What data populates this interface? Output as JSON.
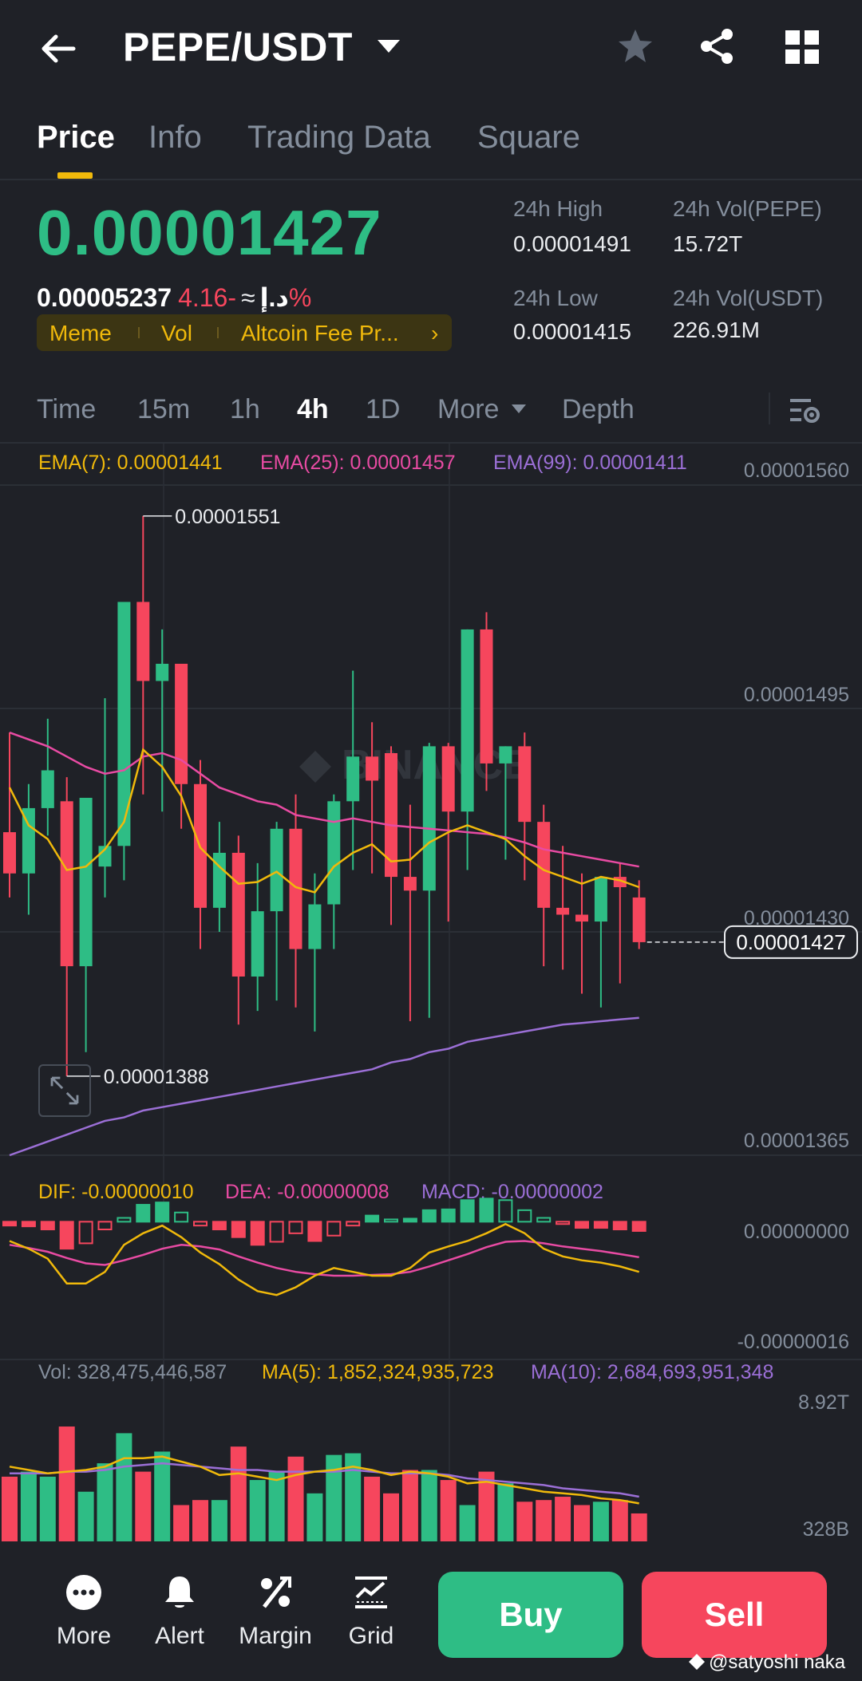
{
  "header": {
    "pair": "PEPE/USDT",
    "icons": [
      "back-arrow-icon",
      "caret-down-icon",
      "star-icon",
      "share-icon",
      "grid-icon"
    ]
  },
  "tabs": [
    {
      "label": "Price",
      "active": true
    },
    {
      "label": "Info",
      "active": false
    },
    {
      "label": "Trading Data",
      "active": false
    },
    {
      "label": "Square",
      "active": false
    }
  ],
  "ticker": {
    "last_price": "0.00001427",
    "fiat_price": "0.00005237",
    "fiat_symbol": "د.إ",
    "approx": "≈",
    "change": "-4.16%",
    "tags": [
      "Meme",
      "Vol",
      "Altcoin Fee Pr..."
    ],
    "tag_chevron": "›",
    "high_label": "24h High",
    "high_value": "0.00001491",
    "low_label": "24h Low",
    "low_value": "0.00001415",
    "vol_base_label": "24h Vol(PEPE)",
    "vol_base_value": "15.72T",
    "vol_quote_label": "24h Vol(USDT)",
    "vol_quote_value": "226.91M"
  },
  "timeframes": [
    {
      "label": "Time",
      "active": false
    },
    {
      "label": "15m",
      "active": false
    },
    {
      "label": "1h",
      "active": false
    },
    {
      "label": "4h",
      "active": true
    },
    {
      "label": "1D",
      "active": false
    },
    {
      "label": "More",
      "active": false
    },
    {
      "label": "Depth",
      "active": false
    }
  ],
  "colors": {
    "up": "#2ebd85",
    "down": "#f6465d",
    "ema7": "#f0b90b",
    "ema25": "#e84ba3",
    "ema99": "#9b6fd6",
    "grid": "#2b2f36",
    "accent": "#f0b90b",
    "background": "#1f2127"
  },
  "chart_data": {
    "type": "candlestick",
    "interval": "4h",
    "indicators": {
      "ema7": "EMA(7): 0.00001441",
      "ema25": "EMA(25): 0.00001457",
      "ema99": "EMA(99): 0.00001411"
    },
    "y_ticks": [
      "0.00001560",
      "0.00001495",
      "0.00001430",
      "0.00001365"
    ],
    "ylim": [
      1.365e-05,
      1.56e-05
    ],
    "current_price_label": "0.00001427",
    "current_price": 1.427e-05,
    "high_marker": {
      "label": "0.00001551",
      "value": 1.551e-05,
      "index": 7
    },
    "low_marker": {
      "label": "0.00001388",
      "value": 1.388e-05,
      "index": 3
    },
    "candles": [
      {
        "o": 1.459,
        "h": 1.488,
        "l": 1.44,
        "c": 1.447
      },
      {
        "o": 1.447,
        "h": 1.473,
        "l": 1.435,
        "c": 1.466
      },
      {
        "o": 1.466,
        "h": 1.492,
        "l": 1.458,
        "c": 1.477
      },
      {
        "o": 1.468,
        "h": 1.475,
        "l": 1.388,
        "c": 1.42
      },
      {
        "o": 1.42,
        "h": 1.452,
        "l": 1.395,
        "c": 1.469
      },
      {
        "o": 1.449,
        "h": 1.498,
        "l": 1.44,
        "c": 1.455
      },
      {
        "o": 1.455,
        "h": 1.52,
        "l": 1.445,
        "c": 1.526
      },
      {
        "o": 1.526,
        "h": 1.551,
        "l": 1.47,
        "c": 1.503
      },
      {
        "o": 1.503,
        "h": 1.518,
        "l": 1.465,
        "c": 1.508
      },
      {
        "o": 1.508,
        "h": 1.5,
        "l": 1.46,
        "c": 1.473
      },
      {
        "o": 1.473,
        "h": 1.48,
        "l": 1.425,
        "c": 1.437
      },
      {
        "o": 1.437,
        "h": 1.462,
        "l": 1.43,
        "c": 1.453
      },
      {
        "o": 1.453,
        "h": 1.458,
        "l": 1.403,
        "c": 1.417
      },
      {
        "o": 1.417,
        "h": 1.45,
        "l": 1.407,
        "c": 1.436
      },
      {
        "o": 1.436,
        "h": 1.462,
        "l": 1.41,
        "c": 1.46
      },
      {
        "o": 1.46,
        "h": 1.47,
        "l": 1.408,
        "c": 1.425
      },
      {
        "o": 1.425,
        "h": 1.447,
        "l": 1.401,
        "c": 1.438
      },
      {
        "o": 1.438,
        "h": 1.47,
        "l": 1.425,
        "c": 1.468
      },
      {
        "o": 1.468,
        "h": 1.506,
        "l": 1.448,
        "c": 1.481
      },
      {
        "o": 1.481,
        "h": 1.491,
        "l": 1.447,
        "c": 1.474
      },
      {
        "o": 1.482,
        "h": 1.484,
        "l": 1.432,
        "c": 1.446
      },
      {
        "o": 1.446,
        "h": 1.467,
        "l": 1.404,
        "c": 1.442
      },
      {
        "o": 1.442,
        "h": 1.485,
        "l": 1.405,
        "c": 1.484
      },
      {
        "o": 1.484,
        "h": 1.485,
        "l": 1.433,
        "c": 1.465
      },
      {
        "o": 1.465,
        "h": 1.497,
        "l": 1.448,
        "c": 1.518
      },
      {
        "o": 1.518,
        "h": 1.523,
        "l": 1.471,
        "c": 1.479
      },
      {
        "o": 1.479,
        "h": 1.484,
        "l": 1.451,
        "c": 1.484
      },
      {
        "o": 1.484,
        "h": 1.488,
        "l": 1.445,
        "c": 1.462
      },
      {
        "o": 1.462,
        "h": 1.467,
        "l": 1.42,
        "c": 1.437
      },
      {
        "o": 1.437,
        "h": 1.455,
        "l": 1.419,
        "c": 1.435
      },
      {
        "o": 1.435,
        "h": 1.447,
        "l": 1.412,
        "c": 1.433
      },
      {
        "o": 1.433,
        "h": 1.443,
        "l": 1.408,
        "c": 1.446
      },
      {
        "o": 1.446,
        "h": 1.45,
        "l": 1.415,
        "c": 1.443
      },
      {
        "o": 1.44,
        "h": 1.445,
        "l": 1.425,
        "c": 1.427
      }
    ],
    "ema7_series": [
      1.472,
      1.461,
      1.457,
      1.448,
      1.449,
      1.454,
      1.462,
      1.483,
      1.478,
      1.4695,
      1.4545,
      1.449,
      1.444,
      1.4445,
      1.4475,
      1.443,
      1.4415,
      1.449,
      1.453,
      1.4555,
      1.4505,
      1.451,
      1.456,
      1.459,
      1.461,
      1.459,
      1.457,
      1.452,
      1.448,
      1.446,
      1.444,
      1.446,
      1.445,
      1.443
    ],
    "ema25_series": [
      1.488,
      1.486,
      1.484,
      1.481,
      1.478,
      1.476,
      1.477,
      1.481,
      1.482,
      1.48,
      1.476,
      1.472,
      1.47,
      1.468,
      1.467,
      1.464,
      1.463,
      1.462,
      1.463,
      1.462,
      1.461,
      1.4605,
      1.46,
      1.4595,
      1.459,
      1.4585,
      1.4575,
      1.456,
      1.454,
      1.453,
      1.452,
      1.451,
      1.45,
      1.449
    ],
    "ema99_series": [
      1.365,
      1.367,
      1.369,
      1.371,
      1.373,
      1.375,
      1.376,
      1.378,
      1.379,
      1.38,
      1.381,
      1.382,
      1.383,
      1.384,
      1.385,
      1.386,
      1.387,
      1.388,
      1.389,
      1.39,
      1.392,
      1.393,
      1.395,
      1.396,
      1.398,
      1.399,
      1.4,
      1.401,
      1.402,
      1.403,
      1.4035,
      1.404,
      1.4045,
      1.405
    ],
    "macd": {
      "dif_label": "DIF: -0.00000010",
      "dea_label": "DEA: -0.00000008",
      "macd_label": "MACD: -0.00000002",
      "y_ticks": [
        "0.00000000",
        "-0.00000016"
      ],
      "ylim": [
        -16,
        2
      ],
      "dif": [
        -2.5,
        -3.5,
        -4.8,
        -8.0,
        -8.0,
        -6.5,
        -3.0,
        -1.5,
        -0.5,
        -2.0,
        -4.0,
        -5.5,
        -7.5,
        -9.0,
        -9.5,
        -8.5,
        -7.0,
        -6.0,
        -6.5,
        -7.0,
        -7.0,
        -6.0,
        -4.0,
        -3.2,
        -2.5,
        -1.5,
        -0.3,
        -1.5,
        -3.5,
        -4.5,
        -5.0,
        -5.3,
        -5.8,
        -6.5
      ],
      "dea": [
        -3.0,
        -3.4,
        -3.9,
        -4.7,
        -5.4,
        -5.6,
        -5.0,
        -4.3,
        -3.5,
        -3.0,
        -3.2,
        -3.6,
        -4.5,
        -5.3,
        -6.0,
        -6.5,
        -6.8,
        -7.0,
        -7.0,
        -6.9,
        -6.8,
        -6.5,
        -5.8,
        -5.0,
        -4.2,
        -3.3,
        -2.6,
        -2.5,
        -2.8,
        -3.2,
        -3.5,
        -3.8,
        -4.2,
        -4.6
      ],
      "hist": [
        -0.5,
        -0.6,
        -1.0,
        -3.5,
        -2.8,
        -1.0,
        0.5,
        2.2,
        2.5,
        1.2,
        -0.5,
        -1.0,
        -2.0,
        -3.0,
        -2.6,
        -1.5,
        -2.5,
        -1.8,
        -0.5,
        0.8,
        0.3,
        0.4,
        1.5,
        1.6,
        2.8,
        3.0,
        2.8,
        1.5,
        0.5,
        -0.3,
        -0.8,
        -0.8,
        -1.0,
        -1.2
      ]
    },
    "volume": {
      "vol_label": "Vol: 328,475,446,587",
      "ma5_label": "MA(5): 1,852,324,935,723",
      "ma10_label": "MA(10): 2,684,693,951,348",
      "y_ticks": [
        "8.92T",
        "328B"
      ],
      "ylim": [
        0.328,
        8.92
      ],
      "bars": [
        4.2,
        4.5,
        4.2,
        7.2,
        3.3,
        5.0,
        6.8,
        4.5,
        5.7,
        2.5,
        2.8,
        2.8,
        6.0,
        4.0,
        4.5,
        5.4,
        3.2,
        5.5,
        5.6,
        4.2,
        3.2,
        4.6,
        4.6,
        4.0,
        2.5,
        4.5,
        3.8,
        2.7,
        2.8,
        3.0,
        2.5,
        2.7,
        2.8,
        2.0
      ],
      "ma5": [
        4.8,
        4.6,
        4.4,
        4.5,
        4.6,
        4.8,
        5.3,
        5.3,
        5.4,
        5.1,
        4.8,
        4.3,
        4.4,
        4.2,
        4.0,
        4.3,
        4.5,
        4.6,
        4.8,
        4.6,
        4.3,
        4.5,
        4.4,
        4.2,
        3.8,
        3.9,
        3.7,
        3.5,
        3.3,
        3.2,
        3.1,
        2.9,
        2.8,
        2.6
      ],
      "ma10": [
        4.4,
        4.4,
        4.4,
        4.5,
        4.5,
        4.6,
        4.8,
        4.9,
        5.0,
        4.9,
        4.8,
        4.7,
        4.6,
        4.6,
        4.5,
        4.5,
        4.5,
        4.5,
        4.6,
        4.5,
        4.4,
        4.4,
        4.4,
        4.3,
        4.1,
        4.0,
        3.9,
        3.8,
        3.7,
        3.5,
        3.4,
        3.3,
        3.2,
        3.0
      ]
    },
    "watermark_text": "BINANCE"
  },
  "bottom_nav": [
    {
      "label": "More",
      "icon": "more-dots-icon"
    },
    {
      "label": "Alert",
      "icon": "bell-icon"
    },
    {
      "label": "Margin",
      "icon": "percent-icon"
    },
    {
      "label": "Grid",
      "icon": "grid-chart-icon"
    }
  ],
  "actions": {
    "buy": "Buy",
    "sell": "Sell"
  },
  "credit": "@satyoshi naka"
}
